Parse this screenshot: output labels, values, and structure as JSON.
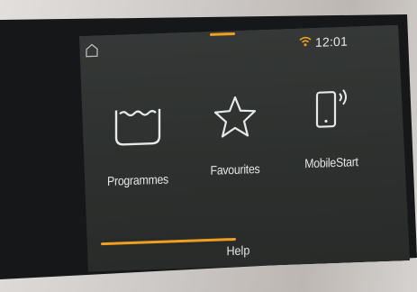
{
  "status_bar": {
    "time": "12:01",
    "icons": [
      "home-icon",
      "wifi-icon"
    ]
  },
  "tiles": [
    {
      "label": "Programmes",
      "icon": "basin-icon"
    },
    {
      "label": "Favourites",
      "icon": "star-icon"
    },
    {
      "label": "MobileStart",
      "icon": "phone-signal-icon"
    }
  ],
  "bottom": {
    "help_label": "Help"
  },
  "colors": {
    "accent": "#f0a020",
    "screen_bg": "#303331",
    "bezel": "#161719",
    "text": "#e6e6e6"
  }
}
